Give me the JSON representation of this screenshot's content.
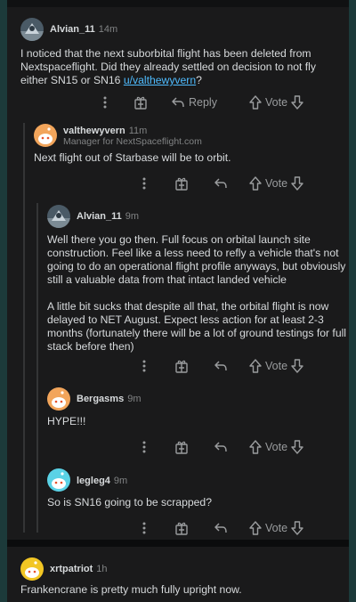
{
  "comments": [
    {
      "user": "Alvian_11",
      "time": "14m",
      "text_before_link": "I noticed that the next suborbital flight has been deleted from Nextspaceflight. Did they already settled on decision to not fly either SN15 or SN16 ",
      "link": "u/valthewyvern",
      "text_after_link": "?",
      "reply_label": "Reply",
      "vote_label": "Vote"
    },
    {
      "user": "valthewyvern",
      "time": "11m",
      "flair": "Manager for NextSpaceflight.com",
      "text": "Next flight out of Starbase will be to orbit.",
      "vote_label": "Vote"
    },
    {
      "user": "Alvian_11",
      "time": "9m",
      "paragraphs": [
        "Well there you go then. Full focus on orbital launch site construction. Feel like a less need to refly a vehicle that's not going to do an operational flight profile anyways, but obviously still a valuable data from that intact landed vehicle",
        "A little bit sucks that despite all that, the orbital flight is now delayed to NET August. Expect less action for at least 2-3 months (fortunately there will be a lot of ground testings for full stack before then)"
      ],
      "vote_label": "Vote"
    },
    {
      "user": "Bergasms",
      "time": "9m",
      "text": "HYPE!!!",
      "vote_label": "Vote"
    },
    {
      "user": "legleg4",
      "time": "9m",
      "text": "So is SN16 going to be scrapped?",
      "vote_label": "Vote"
    },
    {
      "user": "xrtpatriot",
      "time": "1h",
      "text": "Frankencrane is pretty much fully upright now."
    }
  ],
  "icons": [
    "more-vertical-icon",
    "award-icon",
    "reply-arrow-icon",
    "upvote-arrow-icon",
    "downvote-arrow-icon"
  ],
  "colors": {
    "background": "#0b0c0d",
    "card": "#1a1a1b",
    "text": "#d7dadc",
    "muted": "#818384",
    "link": "#4fbcff",
    "frame": "#1c3a3a",
    "avatar_orange": "#f2a55b",
    "avatar_cyan": "#5ad2e6",
    "avatar_yellow": "#f2c624"
  }
}
